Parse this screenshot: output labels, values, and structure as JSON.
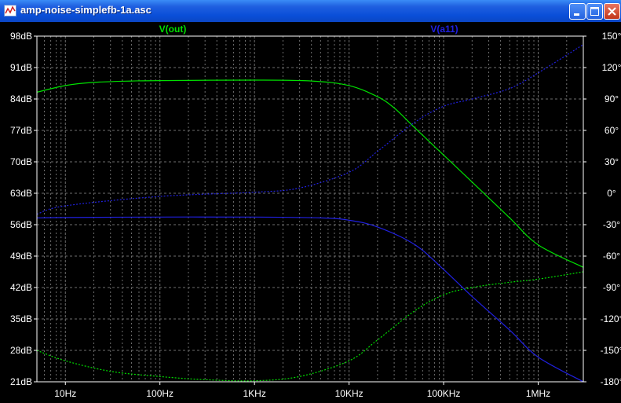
{
  "window": {
    "title": "amp-noise-simplefb-1a.asc",
    "icon": "ltspice-waveform-icon"
  },
  "colors": {
    "background": "#000000",
    "axis_text": "#ffffff",
    "grid": "#6e6e6e",
    "vout": "#00e000",
    "va11": "#2020e0"
  },
  "chart_data": {
    "type": "line",
    "title": "",
    "xscale": "log",
    "xlim": [
      5,
      3000000
    ],
    "x_ticks": [
      "10Hz",
      "100Hz",
      "1KHz",
      "10KHz",
      "100KHz",
      "1MHz"
    ],
    "y_left": {
      "label": "",
      "ylim": [
        21,
        98
      ],
      "ticks": [
        "98dB",
        "91dB",
        "84dB",
        "77dB",
        "70dB",
        "63dB",
        "56dB",
        "49dB",
        "42dB",
        "35dB",
        "28dB",
        "21dB"
      ]
    },
    "y_right": {
      "label": "",
      "ylim": [
        -180,
        150
      ],
      "ticks": [
        "150°",
        "120°",
        "90°",
        "60°",
        "30°",
        "0°",
        "-30°",
        "-60°",
        "-90°",
        "-120°",
        "-150°",
        "-180°"
      ]
    },
    "grid": true,
    "series": [
      {
        "name": "V(out)",
        "quantity": "magnitude",
        "axis": "left",
        "style": "solid",
        "color": "#00e000",
        "x": [
          5,
          10,
          20,
          50,
          100,
          1000,
          4000,
          10000,
          20000,
          30000,
          50000,
          100000,
          200000,
          500000,
          1000000,
          3000000
        ],
        "y": [
          85.5,
          87,
          87.7,
          88,
          88.1,
          88.2,
          88.0,
          87.0,
          84.5,
          82.0,
          77.5,
          71.5,
          65.5,
          57.5,
          51.5,
          46.5
        ]
      },
      {
        "name": "V(out)",
        "quantity": "phase",
        "axis": "right",
        "style": "dashed",
        "color": "#00e000",
        "x": [
          5,
          10,
          30,
          100,
          300,
          1000,
          3000,
          10000,
          20000,
          50000,
          100000,
          200000,
          500000,
          1000000,
          3000000
        ],
        "y": [
          -150,
          -160,
          -170,
          -175,
          -178,
          -179,
          -175,
          -160,
          -140,
          -112,
          -97,
          -90,
          -85,
          -82,
          -75
        ]
      },
      {
        "name": "V(a11)",
        "quantity": "magnitude",
        "axis": "left",
        "style": "solid",
        "color": "#2020e0",
        "x": [
          5,
          10,
          100,
          1000,
          5000,
          10000,
          20000,
          50000,
          100000,
          200000,
          500000,
          1000000,
          3000000
        ],
        "y": [
          57.5,
          57.6,
          57.7,
          57.7,
          57.5,
          57.0,
          55.5,
          51.5,
          46.0,
          40.0,
          32.5,
          26.5,
          21.0
        ]
      },
      {
        "name": "V(a11)",
        "quantity": "phase",
        "axis": "right",
        "style": "dashed",
        "color": "#2020e0",
        "x": [
          5,
          10,
          100,
          1000,
          3000,
          10000,
          20000,
          50000,
          100000,
          200000,
          500000,
          1000000,
          3000000
        ],
        "y": [
          -20,
          -12,
          -3,
          1,
          5,
          20,
          40,
          68,
          83,
          90,
          100,
          115,
          142
        ]
      }
    ]
  }
}
